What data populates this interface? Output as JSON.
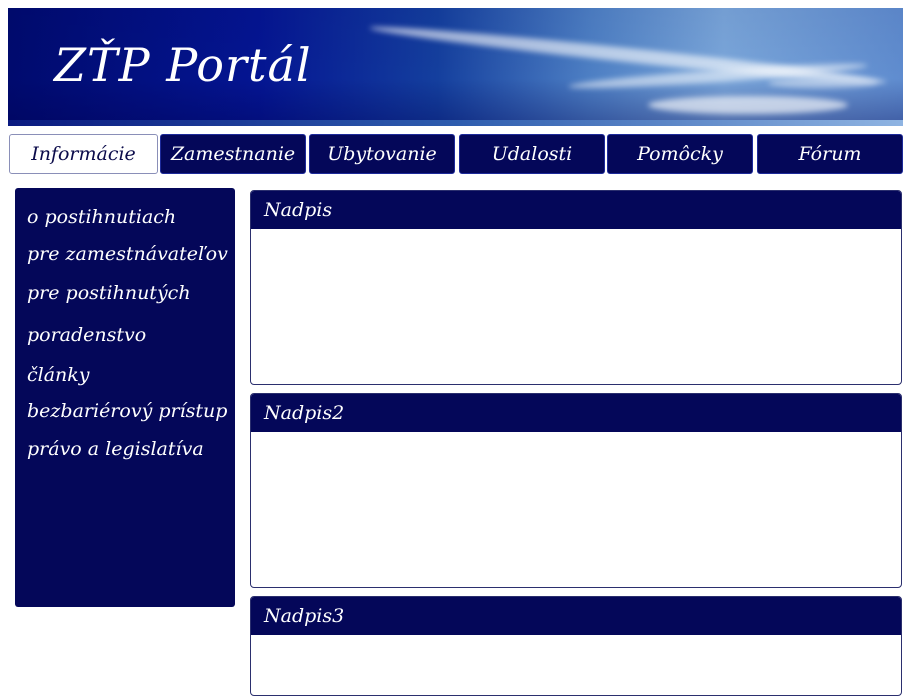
{
  "header": {
    "title": "ZŤP Portál"
  },
  "nav": {
    "tabs": [
      {
        "label": "Informácie",
        "active": true
      },
      {
        "label": "Zamestnanie",
        "active": false
      },
      {
        "label": "Ubytovanie",
        "active": false
      },
      {
        "label": "Udalosti",
        "active": false
      },
      {
        "label": "Pomôcky",
        "active": false
      },
      {
        "label": "Fórum",
        "active": false
      }
    ]
  },
  "sidebar": {
    "items": [
      {
        "label": "o postihnutiach"
      },
      {
        "label": "pre zamestnávateľov"
      },
      {
        "label": "pre postihnutých"
      },
      {
        "label": "poradenstvo"
      },
      {
        "label": "články"
      },
      {
        "label": "bezbariérový prístup"
      },
      {
        "label": "právo a legislatíva"
      }
    ]
  },
  "main": {
    "panels": [
      {
        "title": "Nadpis"
      },
      {
        "title": "Nadpis2"
      },
      {
        "title": "Nadpis3"
      }
    ]
  },
  "colors": {
    "navy": "#040759",
    "header_dark": "#000a6e",
    "sky": "#7aa6da",
    "white": "#ffffff"
  }
}
